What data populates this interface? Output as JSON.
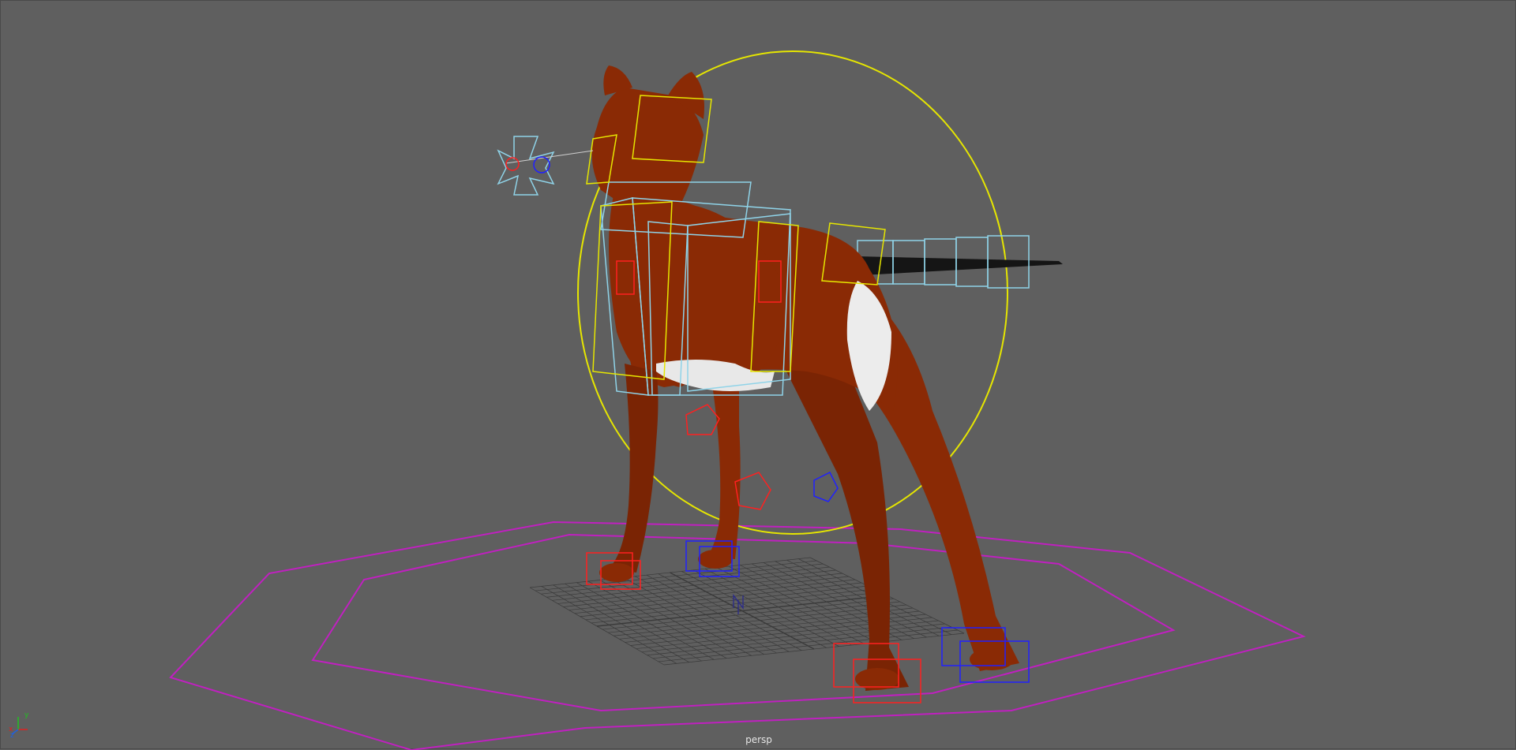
{
  "viewport": {
    "camera_name": "persp",
    "background_color": "#5f5f5f",
    "grid_color": "#3a3a3a",
    "mesh_colors": {
      "body": "#8a2a05",
      "body_shadow": "#6a1e03",
      "belly_patch": "#e8e8e8",
      "tail": "#1a1a1a"
    },
    "control_colors": {
      "main_circle": "#e6e600",
      "fk_boxes": "#8fd3e8",
      "left_controls": "#ff2020",
      "right_controls": "#2020ff",
      "ground_octagons": "#c020c0"
    },
    "axis_gizmo": {
      "x_label": "x",
      "y_label": "y",
      "z_label": "z"
    },
    "icons": [
      "axis-gizmo-icon",
      "north-compass-icon"
    ]
  }
}
